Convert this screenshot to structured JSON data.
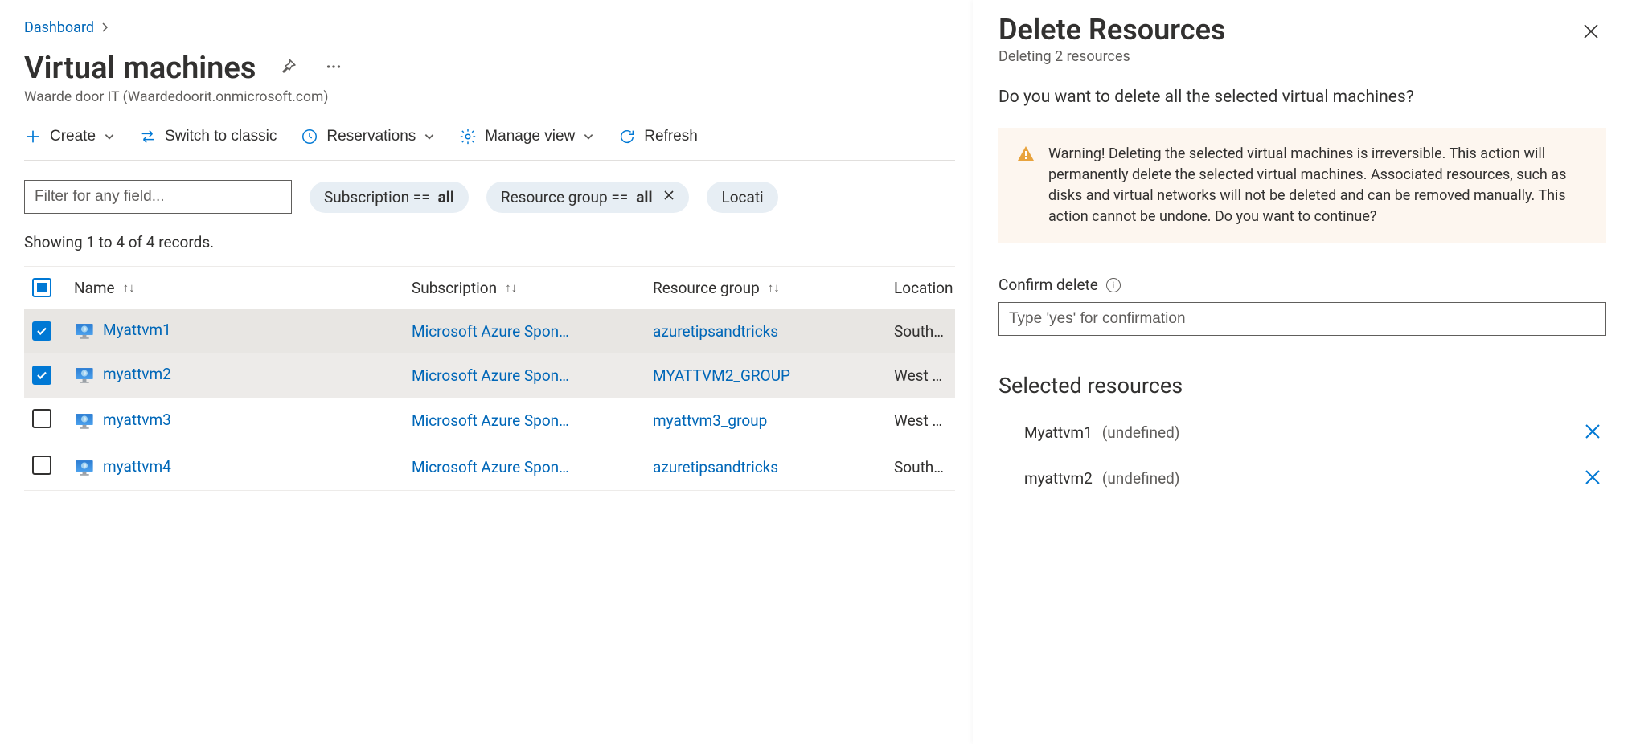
{
  "breadcrumb": {
    "root": "Dashboard"
  },
  "page": {
    "title": "Virtual machines",
    "subtitle": "Waarde door IT (Waardedoorit.onmicrosoft.com)"
  },
  "toolbar": {
    "create": "Create",
    "switch": "Switch to classic",
    "reservations": "Reservations",
    "manage_view": "Manage view",
    "refresh": "Refresh"
  },
  "filters": {
    "placeholder": "Filter for any field...",
    "pill_sub_pre": "Subscription == ",
    "pill_sub_val": "all",
    "pill_rg_pre": "Resource group == ",
    "pill_rg_val": "all",
    "pill_loc": "Locati"
  },
  "records_text": "Showing 1 to 4 of 4 records.",
  "columns": {
    "name": "Name",
    "subscription": "Subscription",
    "resource_group": "Resource group",
    "location": "Location"
  },
  "rows": [
    {
      "selected": true,
      "name": "Myattvm1",
      "subscription": "Microsoft Azure Spon…",
      "rg": "azuretipsandtricks",
      "location": "South Cent"
    },
    {
      "selected": true,
      "name": "myattvm2",
      "subscription": "Microsoft Azure Spon…",
      "rg": "MYATTVM2_GROUP",
      "location": "West Europ"
    },
    {
      "selected": false,
      "name": "myattvm3",
      "subscription": "Microsoft Azure Spon…",
      "rg": "myattvm3_group",
      "location": "West Europ"
    },
    {
      "selected": false,
      "name": "myattvm4",
      "subscription": "Microsoft Azure Spon…",
      "rg": "azuretipsandtricks",
      "location": "South Cent"
    }
  ],
  "panel": {
    "title": "Delete Resources",
    "subtitle": "Deleting 2 resources",
    "question": "Do you want to delete all the selected virtual machines?",
    "warning": "Warning! Deleting the selected virtual machines is irreversible. This action will permanently delete the selected virtual machines. Associated resources, such as disks and virtual networks will not be deleted and can be removed manually. This action cannot be undone. Do you want to continue?",
    "confirm_label": "Confirm delete",
    "confirm_placeholder": "Type 'yes' for confirmation",
    "selected_title": "Selected resources",
    "selected": [
      {
        "name": "Myattvm1",
        "status": "(undefined)"
      },
      {
        "name": "myattvm2",
        "status": "(undefined)"
      }
    ]
  }
}
